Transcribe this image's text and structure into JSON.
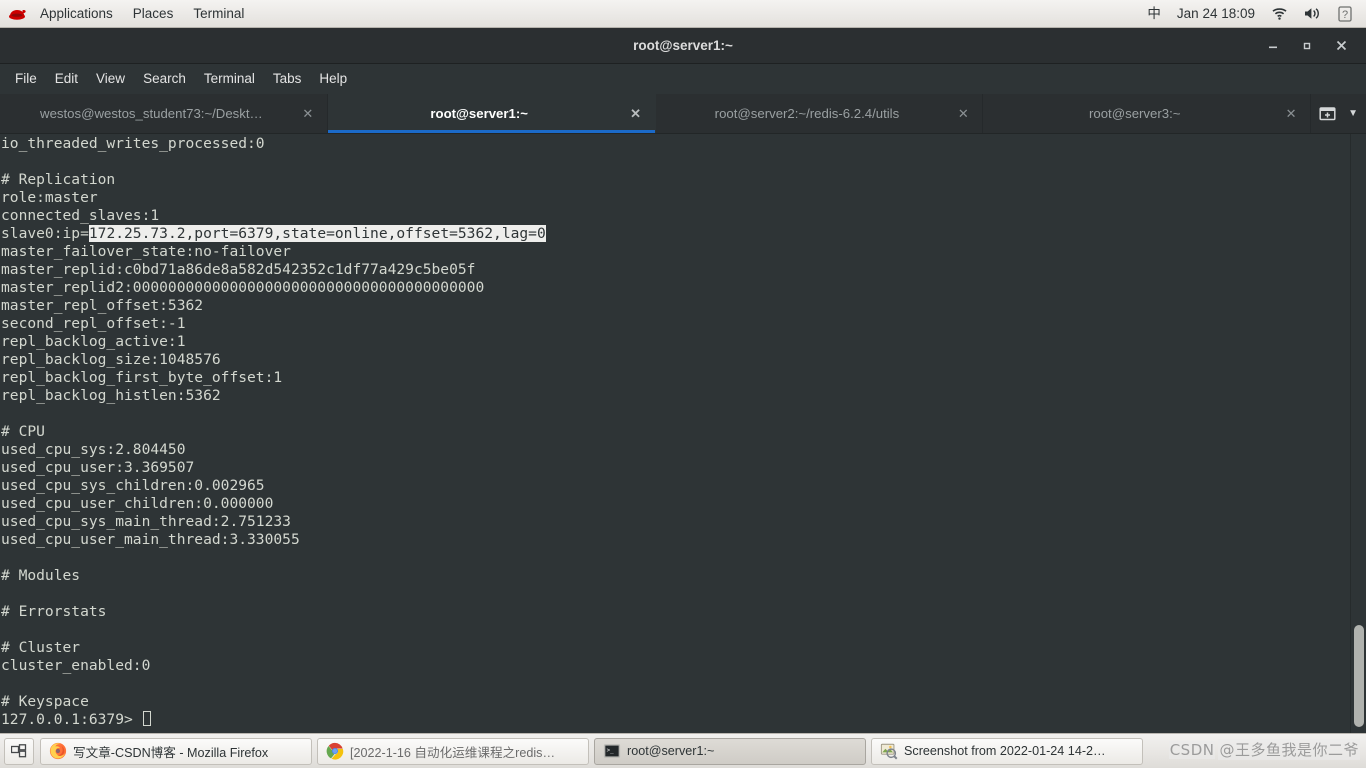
{
  "colors": {
    "accent": "#1b6ac9",
    "terminal_bg": "#2e3436",
    "terminal_fg": "#d3d7cf",
    "selection_bg": "#eeeeec",
    "panel_bg": "#eceae7"
  },
  "top_panel": {
    "logo_name": "red-hat-logo",
    "menus": [
      "Applications",
      "Places",
      "Terminal"
    ],
    "input_method": "中",
    "clock": "Jan 24  18:09",
    "indicators": [
      "wifi-icon",
      "volume-icon",
      "help-icon"
    ]
  },
  "window": {
    "title": "root@server1:~",
    "controls": {
      "minimize": "—",
      "maximize": "▪",
      "close": "✕"
    }
  },
  "menu_bar": [
    "File",
    "Edit",
    "View",
    "Search",
    "Terminal",
    "Tabs",
    "Help"
  ],
  "tabs": [
    {
      "label": "westos@westos_student73:~/Deskt…",
      "active": false,
      "close": "✕"
    },
    {
      "label": "root@server1:~",
      "active": true,
      "close": "✕"
    },
    {
      "label": "root@server2:~/redis-6.2.4/utils",
      "active": false,
      "close": "✕"
    },
    {
      "label": "root@server3:~",
      "active": false,
      "close": "✕"
    }
  ],
  "tab_actions": {
    "new_tab": "new-tab-icon",
    "tab_list": "▼"
  },
  "terminal": {
    "lines": [
      "io_threaded_writes_processed:0",
      "",
      "# Replication",
      "role:master",
      "connected_slaves:1",
      "__SELECTED_LINE__",
      "master_failover_state:no-failover",
      "master_replid:c0bd71a86de8a582d542352c1df77a429c5be05f",
      "master_replid2:0000000000000000000000000000000000000000",
      "master_repl_offset:5362",
      "second_repl_offset:-1",
      "repl_backlog_active:1",
      "repl_backlog_size:1048576",
      "repl_backlog_first_byte_offset:1",
      "repl_backlog_histlen:5362",
      "",
      "# CPU",
      "used_cpu_sys:2.804450",
      "used_cpu_user:3.369507",
      "used_cpu_sys_children:0.002965",
      "used_cpu_user_children:0.000000",
      "used_cpu_sys_main_thread:2.751233",
      "used_cpu_user_main_thread:3.330055",
      "",
      "# Modules",
      "",
      "# Errorstats",
      "",
      "# Cluster",
      "cluster_enabled:0",
      "",
      "# Keyspace",
      "__PROMPT_LINE__"
    ],
    "selected_line": {
      "prefix": "slave0:ip=",
      "highlighted": "172.25.73.2,port=6379,state=online,offset=5362,lag=0"
    },
    "prompt": "127.0.0.1:6379>",
    "scrollbar": {
      "thumb_top_pct": 82,
      "thumb_height_pct": 17
    }
  },
  "taskbar": {
    "workspace_switcher": "workspace-switcher-icon",
    "items": [
      {
        "label": "写文章-CSDN博客 - Mozilla Firefox",
        "icon": "firefox-icon",
        "state": "normal"
      },
      {
        "label": "[2022-1-16 自动化运维课程之redis…",
        "icon": "chrome-icon",
        "state": "inactive"
      },
      {
        "label": "root@server1:~",
        "icon": "terminal-icon",
        "state": "active"
      },
      {
        "label": "Screenshot from 2022-01-24 14-2…",
        "icon": "image-viewer-icon",
        "state": "normal"
      }
    ]
  },
  "watermark": {
    "brand": "CSDN",
    "author": "@王多鱼我是你二爷"
  }
}
